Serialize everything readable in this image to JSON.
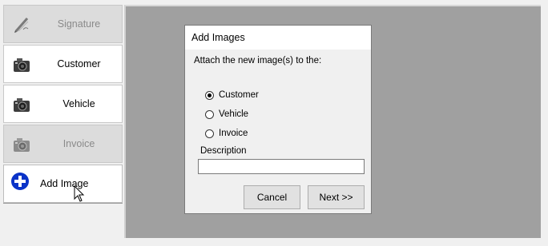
{
  "sidebar": {
    "items": [
      {
        "label": "Signature",
        "icon": "pen-icon",
        "state": "disabled"
      },
      {
        "label": "Customer",
        "icon": "camera-icon",
        "state": "enabled"
      },
      {
        "label": "Vehicle",
        "icon": "camera-icon",
        "state": "enabled"
      },
      {
        "label": "Invoice",
        "icon": "camera-icon",
        "state": "disabled"
      },
      {
        "label": "Add Image",
        "icon": "plus-circle-icon",
        "state": "hovered"
      }
    ]
  },
  "dialog": {
    "title": "Add Images",
    "prompt": "Attach the new image(s) to the:",
    "options": [
      {
        "label": "Customer",
        "selected": true
      },
      {
        "label": "Vehicle",
        "selected": false
      },
      {
        "label": "Invoice",
        "selected": false
      }
    ],
    "description_label": "Description",
    "description_value": "",
    "cancel_label": "Cancel",
    "next_label": "Next >>"
  },
  "colors": {
    "accent_blue": "#0a33c8",
    "panel_gray": "#a0a0a0",
    "disabled_bg": "#dcdcdc"
  }
}
